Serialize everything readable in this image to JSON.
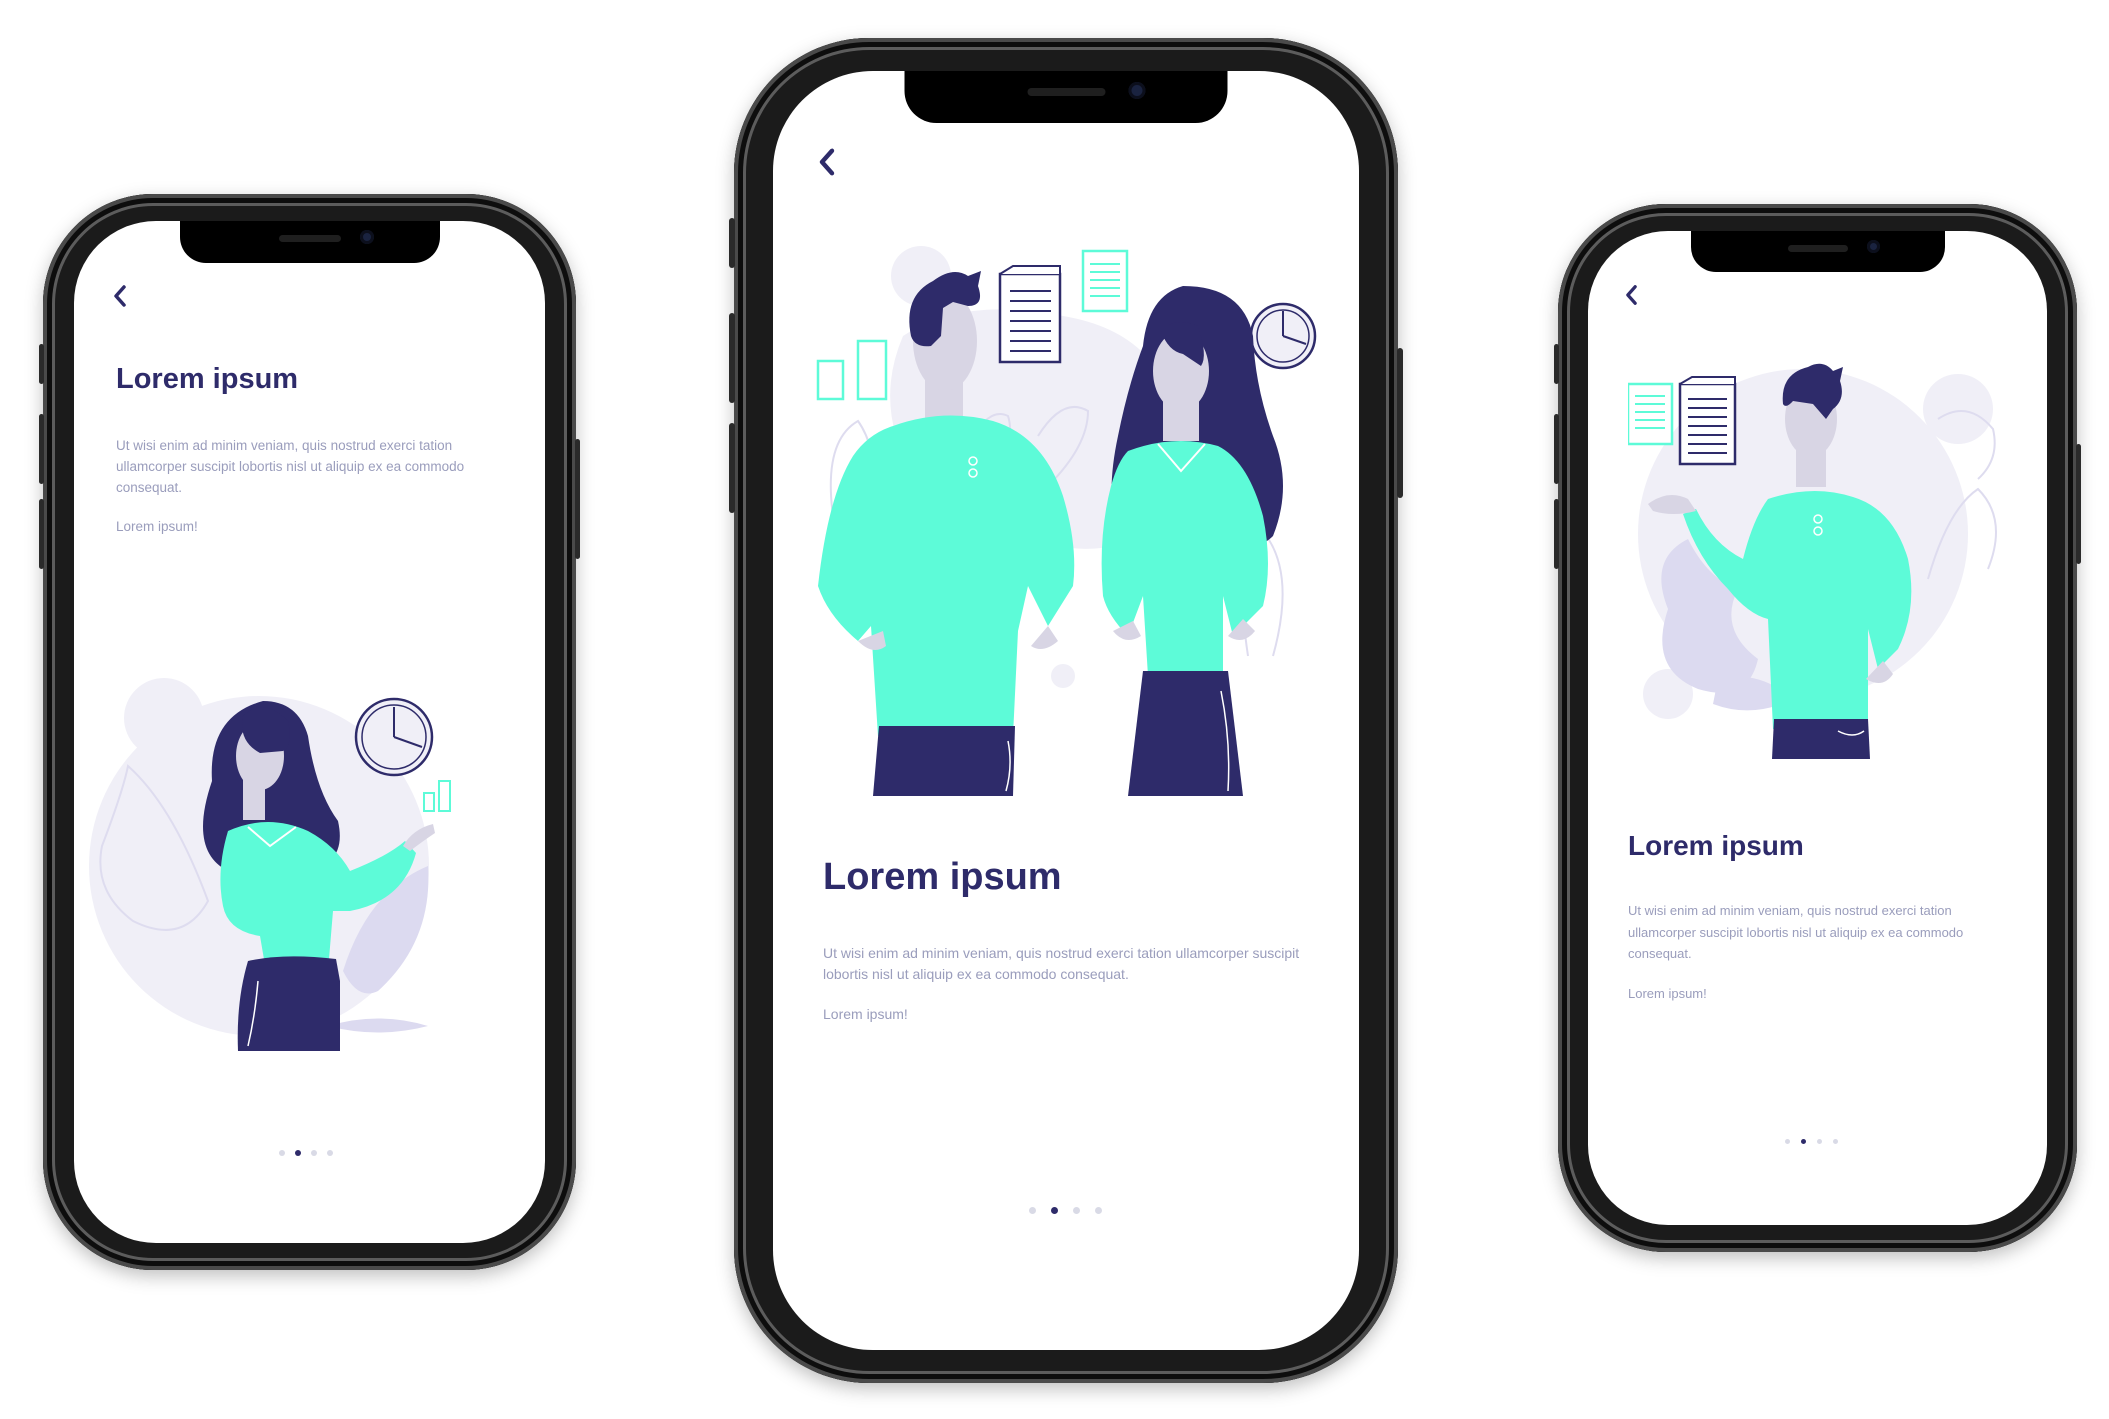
{
  "colors": {
    "accent": "#5dfbd8",
    "navy": "#2e2b6a",
    "skin": "#d8d5e4",
    "blob": "#f0eff7",
    "text_muted": "#9a9dbc",
    "frame": "#1b1b1b"
  },
  "phones": {
    "left": {
      "back_icon": "chevron-left-icon",
      "title": "Lorem ipsum",
      "body": "Ut wisi enim ad minim veniam, quis nostrud exerci tation ullamcorper suscipit lobortis nisl ut aliquip ex ea commodo consequat.",
      "link": "Lorem ipsum!",
      "page_index": 2,
      "page_total": 4
    },
    "center": {
      "back_icon": "chevron-left-icon",
      "title": "Lorem ipsum",
      "body": "Ut wisi enim ad minim veniam, quis nostrud exerci tation ullamcorper suscipit lobortis nisl ut aliquip ex ea commodo consequat.",
      "link": "Lorem ipsum!",
      "page_index": 2,
      "page_total": 4
    },
    "right": {
      "back_icon": "chevron-left-icon",
      "title": "Lorem ipsum",
      "body": "Ut wisi enim ad minim veniam, quis nostrud exerci tation ullamcorper suscipit lobortis nisl ut aliquip ex ea commodo consequat.",
      "link": "Lorem ipsum!",
      "page_index": 2,
      "page_total": 4
    }
  }
}
